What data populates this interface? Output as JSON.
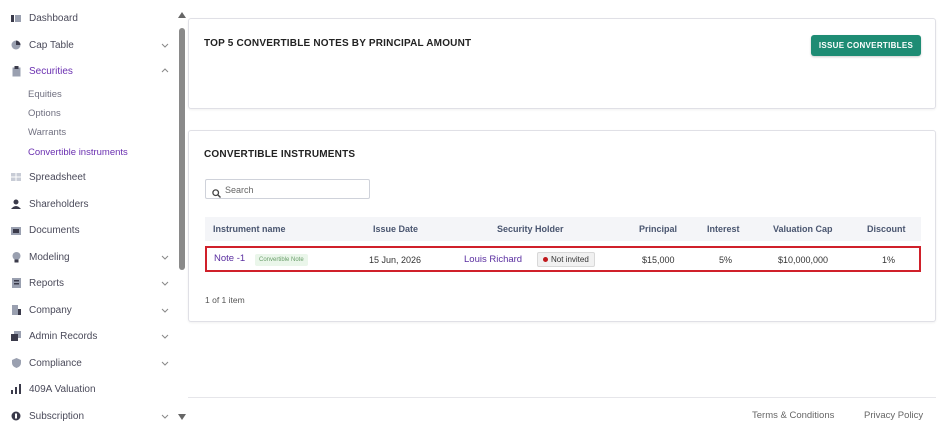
{
  "sidebar": {
    "items": [
      {
        "label": "Dashboard",
        "icon": "dashboard-icon",
        "has_chevron": false
      },
      {
        "label": "Cap Table",
        "icon": "pie-chart-icon",
        "has_chevron": true,
        "chevron": "down"
      },
      {
        "label": "Securities",
        "icon": "clipboard-icon",
        "has_chevron": true,
        "chevron": "up",
        "active": true,
        "children": [
          {
            "label": "Equities"
          },
          {
            "label": "Options"
          },
          {
            "label": "Warrants"
          },
          {
            "label": "Convertible instruments",
            "active": true
          }
        ]
      },
      {
        "label": "Spreadsheet",
        "icon": "spreadsheet-icon",
        "has_chevron": false
      },
      {
        "label": "Shareholders",
        "icon": "user-icon",
        "has_chevron": false
      },
      {
        "label": "Documents",
        "icon": "folder-icon",
        "has_chevron": false
      },
      {
        "label": "Modeling",
        "icon": "bulb-icon",
        "has_chevron": true,
        "chevron": "down"
      },
      {
        "label": "Reports",
        "icon": "report-icon",
        "has_chevron": true,
        "chevron": "down"
      },
      {
        "label": "Company",
        "icon": "building-icon",
        "has_chevron": true,
        "chevron": "down"
      },
      {
        "label": "Admin Records",
        "icon": "records-icon",
        "has_chevron": true,
        "chevron": "down"
      },
      {
        "label": "Compliance",
        "icon": "shield-icon",
        "has_chevron": true,
        "chevron": "down"
      },
      {
        "label": "409A Valuation",
        "icon": "valuation-icon",
        "has_chevron": false
      },
      {
        "label": "Subscription",
        "icon": "subscription-icon",
        "has_chevron": true,
        "chevron": "down"
      }
    ]
  },
  "top_card": {
    "title": "TOP 5 CONVERTIBLE NOTES BY PRINCIPAL AMOUNT",
    "issue_button": "ISSUE CONVERTIBLES"
  },
  "main_card": {
    "title": "CONVERTIBLE INSTRUMENTS",
    "search": {
      "placeholder": "Search",
      "value": ""
    },
    "columns": [
      "Instrument name",
      "Issue Date",
      "Security Holder",
      "Principal",
      "Interest",
      "Valuation Cap",
      "Discount"
    ],
    "rows": [
      {
        "instrument_name": "Note -1",
        "instrument_type": "Convertible Note",
        "issue_date": "15 Jun, 2026",
        "security_holder": "Louis Richard",
        "holder_status": "Not invited",
        "principal": "$15,000",
        "interest": "5%",
        "valuation_cap": "$10,000,000",
        "discount": "1%"
      }
    ],
    "pager_text": "1 of 1 item"
  },
  "footer": {
    "terms": "Terms & Conditions",
    "privacy": "Privacy Policy"
  },
  "colors": {
    "accent_purple": "#6a2fb0",
    "button_green": "#1e8c74",
    "highlight_red": "#d0202a",
    "status_dot": "#c0181c"
  }
}
